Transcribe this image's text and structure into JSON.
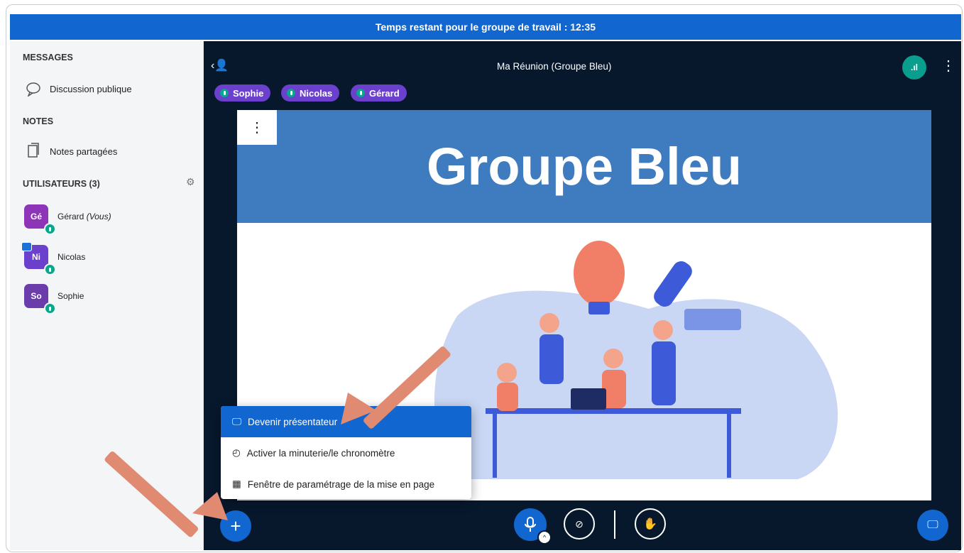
{
  "topbar": {
    "text": "Temps restant pour le groupe de travail : 12:35"
  },
  "sidebar": {
    "messages_title": "MESSAGES",
    "public_chat": "Discussion publique",
    "notes_title": "NOTES",
    "shared_notes": "Notes partagées",
    "users_title": "UTILISATEURS (3)",
    "users": [
      {
        "initials": "Gé",
        "name": "Gérard",
        "suffix": "(Vous)",
        "color": "#8e34b7"
      },
      {
        "initials": "Ni",
        "name": "Nicolas",
        "suffix": "",
        "color": "#6b40cc"
      },
      {
        "initials": "So",
        "name": "Sophie",
        "suffix": "",
        "color": "#6b3dab"
      }
    ]
  },
  "header": {
    "title": "Ma Réunion (Groupe Bleu)",
    "signal_icon": ".ıl"
  },
  "talkers": [
    "Sophie",
    "Nicolas",
    "Gérard"
  ],
  "slide": {
    "title": "Groupe Bleu"
  },
  "menu": {
    "items": [
      {
        "label": "Devenir présentateur",
        "icon": "presentation-icon",
        "active": true
      },
      {
        "label": "Activer la minuterie/le chronomètre",
        "icon": "timer-icon",
        "active": false
      },
      {
        "label": "Fenêtre de paramétrage de la mise en page",
        "icon": "layout-icon",
        "active": false
      }
    ]
  },
  "colors": {
    "primary": "#1167cf",
    "dark": "#07182d",
    "accent_green": "#0aa58b",
    "arrow": "#e08a72"
  }
}
